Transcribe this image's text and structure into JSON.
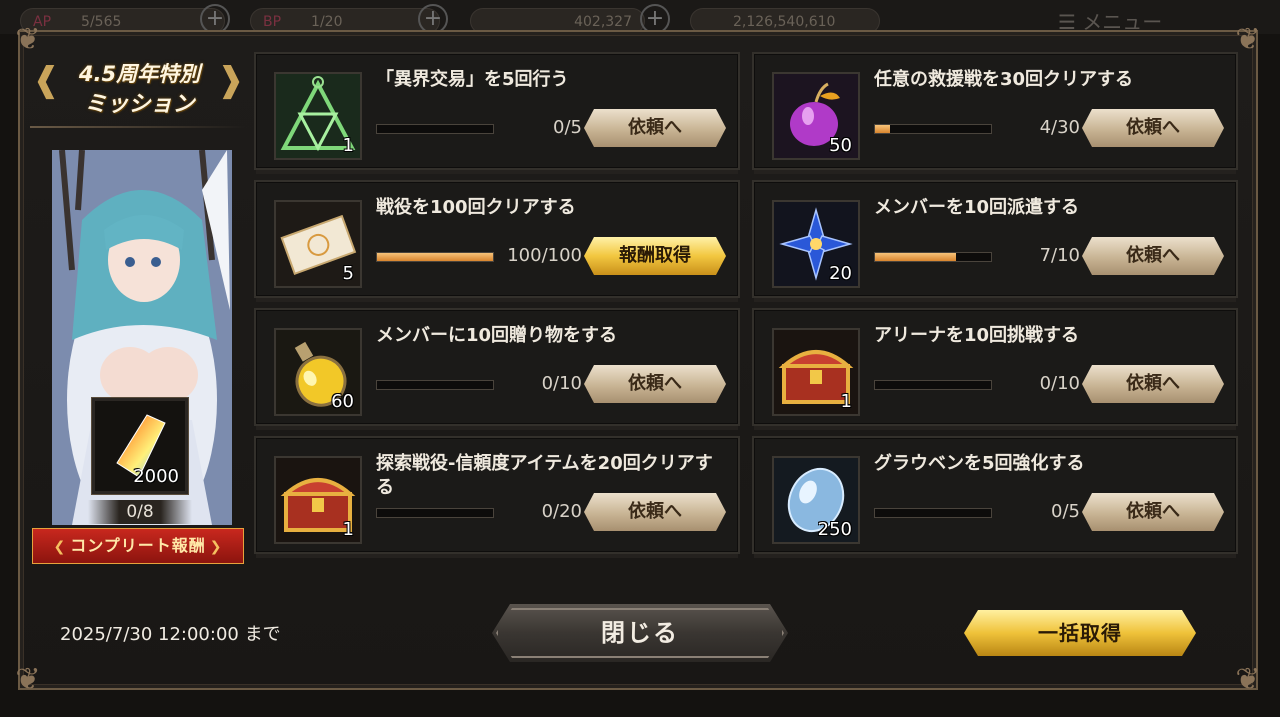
{
  "hud": {
    "ap_label": "AP",
    "ap_value": "5/565",
    "bp_label": "BP",
    "bp_value": "1/20",
    "currency_value": "402,327",
    "gold_value": "2,126,540,610",
    "menu_label": "メニュー"
  },
  "event": {
    "title_line1": "4.5周年特別",
    "title_line2": "ミッション",
    "complete_reward_count": "2000",
    "complete_progress": "0/8",
    "complete_banner": "コンプリート報酬",
    "deadline": "2025/7/30 12:00:00 まで"
  },
  "missions": [
    {
      "title": "「異界交易」を5回行う",
      "progress": "0/5",
      "ratio": 0,
      "icon": "triangle-sigil-icon",
      "count": "1",
      "button": "依頼へ",
      "claimable": false
    },
    {
      "title": "任意の救援戦を30回クリアする",
      "progress": "4/30",
      "ratio": 0.133,
      "icon": "purple-apple-icon",
      "count": "50",
      "button": "依頼へ",
      "claimable": false
    },
    {
      "title": "戦役を100回クリアする",
      "progress": "100/100",
      "ratio": 1,
      "icon": "ticket-icon",
      "count": "5",
      "button": "報酬取得",
      "claimable": true
    },
    {
      "title": "メンバーを10回派遣する",
      "progress": "7/10",
      "ratio": 0.7,
      "icon": "blue-flower-icon",
      "count": "20",
      "button": "依頼へ",
      "claimable": false
    },
    {
      "title": "メンバーに10回贈り物をする",
      "progress": "0/10",
      "ratio": 0,
      "icon": "potion-bottle-icon",
      "count": "60",
      "button": "依頼へ",
      "claimable": false
    },
    {
      "title": "アリーナを10回挑戦する",
      "progress": "0/10",
      "ratio": 0,
      "icon": "treasure-chest-icon",
      "count": "1",
      "button": "依頼へ",
      "claimable": false
    },
    {
      "title": "探索戦役-信頼度アイテムを20回クリアする",
      "progress": "0/20",
      "ratio": 0,
      "icon": "treasure-chest-icon",
      "count": "1",
      "button": "依頼へ",
      "claimable": false
    },
    {
      "title": "グラウベンを5回強化する",
      "progress": "0/5",
      "ratio": 0,
      "icon": "blue-gem-icon",
      "count": "250",
      "button": "依頼へ",
      "claimable": false
    }
  ],
  "footer": {
    "close_label": "閉じる",
    "bulk_claim_label": "一括取得"
  },
  "colors": {
    "accent_gold": "#f2c740",
    "progress_fill": "#e89a44",
    "banner_red": "#c8281e"
  }
}
